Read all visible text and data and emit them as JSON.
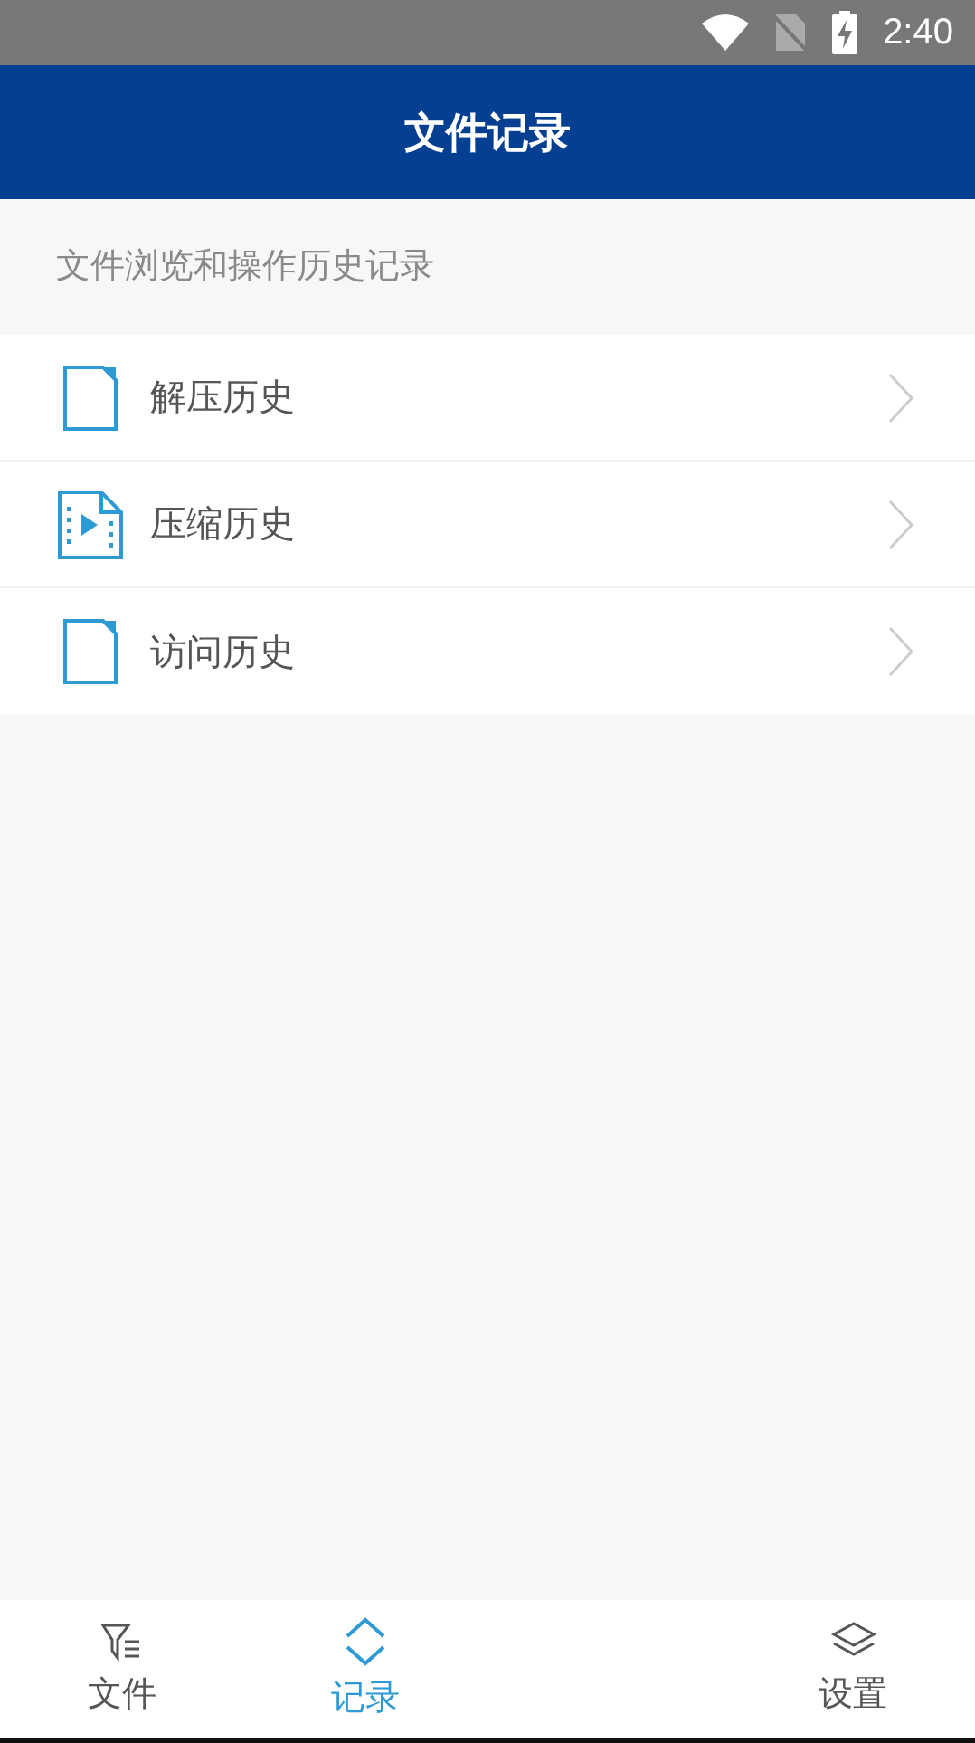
{
  "status_bar": {
    "time": "2:40"
  },
  "header": {
    "title": "文件记录"
  },
  "section": {
    "caption": "文件浏览和操作历史记录"
  },
  "items": [
    {
      "label": "解压历史",
      "kind": "document"
    },
    {
      "label": "压缩历史",
      "kind": "video"
    },
    {
      "label": "访问历史",
      "kind": "document"
    }
  ],
  "tabs": [
    {
      "label": "文件",
      "kind": "filter",
      "selected": false
    },
    {
      "label": "记录",
      "kind": "updown",
      "selected": true
    },
    {
      "label": "设置",
      "kind": "layers",
      "selected": false
    }
  ]
}
